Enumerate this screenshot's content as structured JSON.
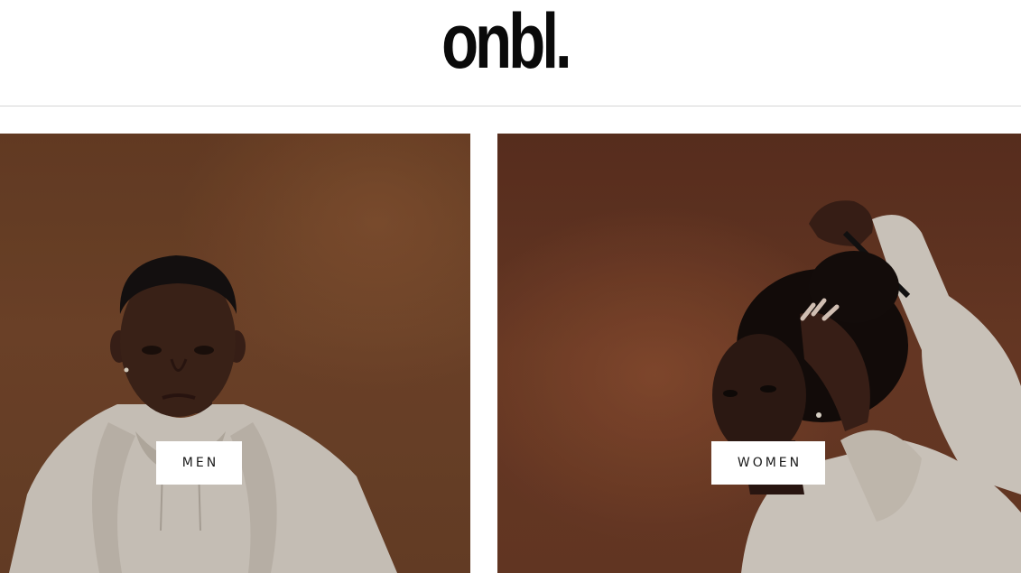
{
  "header": {
    "logo_text": "onbl."
  },
  "categories": [
    {
      "label": "MEN"
    },
    {
      "label": "WOMEN"
    }
  ],
  "colors": {
    "backdrop_men": "#6f4428",
    "backdrop_women": "#653523",
    "button_bg": "#ffffff",
    "text_dark": "#1a1a1a",
    "hoodie": "#ddd6cc"
  }
}
